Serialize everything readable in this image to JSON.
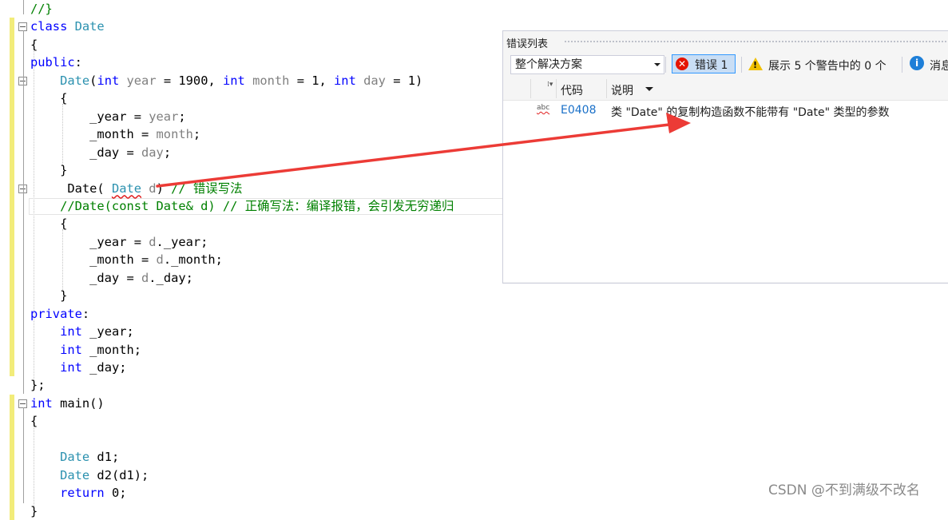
{
  "editor": {
    "lines": [
      [
        {
          "t": "//}",
          "c": "cm"
        }
      ],
      [
        {
          "t": "class",
          "c": "kw"
        },
        {
          "t": " ",
          "c": "pl"
        },
        {
          "t": "Date",
          "c": "ty"
        }
      ],
      [
        {
          "t": "{",
          "c": "pl"
        }
      ],
      [
        {
          "t": "public",
          "c": "kw"
        },
        {
          "t": ":",
          "c": "pl"
        }
      ],
      [
        {
          "t": "    ",
          "c": "pl"
        },
        {
          "t": "Date",
          "c": "ty"
        },
        {
          "t": "(",
          "c": "pl"
        },
        {
          "t": "int",
          "c": "kw"
        },
        {
          "t": " year",
          "c": "pa"
        },
        {
          "t": " = 1900, ",
          "c": "pl"
        },
        {
          "t": "int",
          "c": "kw"
        },
        {
          "t": " month",
          "c": "pa"
        },
        {
          "t": " = 1, ",
          "c": "pl"
        },
        {
          "t": "int",
          "c": "kw"
        },
        {
          "t": " day",
          "c": "pa"
        },
        {
          "t": " = 1)",
          "c": "pl"
        }
      ],
      [
        {
          "t": "    {",
          "c": "pl"
        }
      ],
      [
        {
          "t": "        _year = ",
          "c": "pl"
        },
        {
          "t": "year",
          "c": "pa"
        },
        {
          "t": ";",
          "c": "pl"
        }
      ],
      [
        {
          "t": "        _month = ",
          "c": "pl"
        },
        {
          "t": "month",
          "c": "pa"
        },
        {
          "t": ";",
          "c": "pl"
        }
      ],
      [
        {
          "t": "        _day = ",
          "c": "pl"
        },
        {
          "t": "day",
          "c": "pa"
        },
        {
          "t": ";",
          "c": "pl"
        }
      ],
      [
        {
          "t": "    }",
          "c": "pl"
        }
      ],
      [
        {
          "t": "     Date( ",
          "c": "pl"
        },
        {
          "t": "Date",
          "c": "ty",
          "sq": true
        },
        {
          "t": " d",
          "c": "pa"
        },
        {
          "t": ") ",
          "c": "pl"
        },
        {
          "t": "// 错误写法",
          "c": "cm"
        }
      ],
      [
        {
          "t": "    //Date(const Date& d) // 正确写法：编译报错，会引发无穷递归",
          "c": "cm"
        }
      ],
      [
        {
          "t": "    {",
          "c": "pl"
        }
      ],
      [
        {
          "t": "        _year = ",
          "c": "pl"
        },
        {
          "t": "d",
          "c": "pa"
        },
        {
          "t": "._year;",
          "c": "pl"
        }
      ],
      [
        {
          "t": "        _month = ",
          "c": "pl"
        },
        {
          "t": "d",
          "c": "pa"
        },
        {
          "t": "._month;",
          "c": "pl"
        }
      ],
      [
        {
          "t": "        _day = ",
          "c": "pl"
        },
        {
          "t": "d",
          "c": "pa"
        },
        {
          "t": "._day;",
          "c": "pl"
        }
      ],
      [
        {
          "t": "    }",
          "c": "pl"
        }
      ],
      [
        {
          "t": "private",
          "c": "kw"
        },
        {
          "t": ":",
          "c": "pl"
        }
      ],
      [
        {
          "t": "    ",
          "c": "pl"
        },
        {
          "t": "int",
          "c": "kw"
        },
        {
          "t": " _year;",
          "c": "pl"
        }
      ],
      [
        {
          "t": "    ",
          "c": "pl"
        },
        {
          "t": "int",
          "c": "kw"
        },
        {
          "t": " _month;",
          "c": "pl"
        }
      ],
      [
        {
          "t": "    ",
          "c": "pl"
        },
        {
          "t": "int",
          "c": "kw"
        },
        {
          "t": " _day;",
          "c": "pl"
        }
      ],
      [
        {
          "t": "};",
          "c": "pl"
        }
      ],
      [
        {
          "t": "int",
          "c": "kw"
        },
        {
          "t": " main()",
          "c": "pl"
        }
      ],
      [
        {
          "t": "{",
          "c": "pl"
        }
      ],
      [
        {
          "t": "",
          "c": "pl"
        }
      ],
      [
        {
          "t": "    ",
          "c": "pl"
        },
        {
          "t": "Date",
          "c": "ty"
        },
        {
          "t": " d1;",
          "c": "pl"
        }
      ],
      [
        {
          "t": "    ",
          "c": "pl"
        },
        {
          "t": "Date",
          "c": "ty"
        },
        {
          "t": " d2(d1);",
          "c": "pl"
        }
      ],
      [
        {
          "t": "    ",
          "c": "pl"
        },
        {
          "t": "return",
          "c": "kw"
        },
        {
          "t": " 0;",
          "c": "pl"
        }
      ],
      [
        {
          "t": "}",
          "c": "pl"
        }
      ]
    ]
  },
  "error_list": {
    "title": "错误列表",
    "scope_select": "整个解决方案",
    "errors_button": "错误 1",
    "warnings_label": "展示 5 个警告中的 0 个",
    "messages_label": "消息",
    "columns": {
      "code": "代码",
      "description": "说明"
    },
    "rows": [
      {
        "code": "E0408",
        "description": "类 \"Date\" 的复制构造函数不能带有 \"Date\" 类型的参数"
      }
    ]
  },
  "icons": {
    "error": "error-circle-icon",
    "warning": "warning-triangle-icon",
    "info": "info-circle-icon",
    "spelling": "abc-squiggle-icon"
  },
  "colors": {
    "keyword": "#0000ff",
    "type": "#2b91af",
    "comment": "#008000",
    "parameter": "#808080",
    "change_marker": "#f2ec7a",
    "error_red": "#e51400",
    "annotation_arrow": "#ec3b36"
  },
  "watermark": "CSDN @不到满级不改名"
}
